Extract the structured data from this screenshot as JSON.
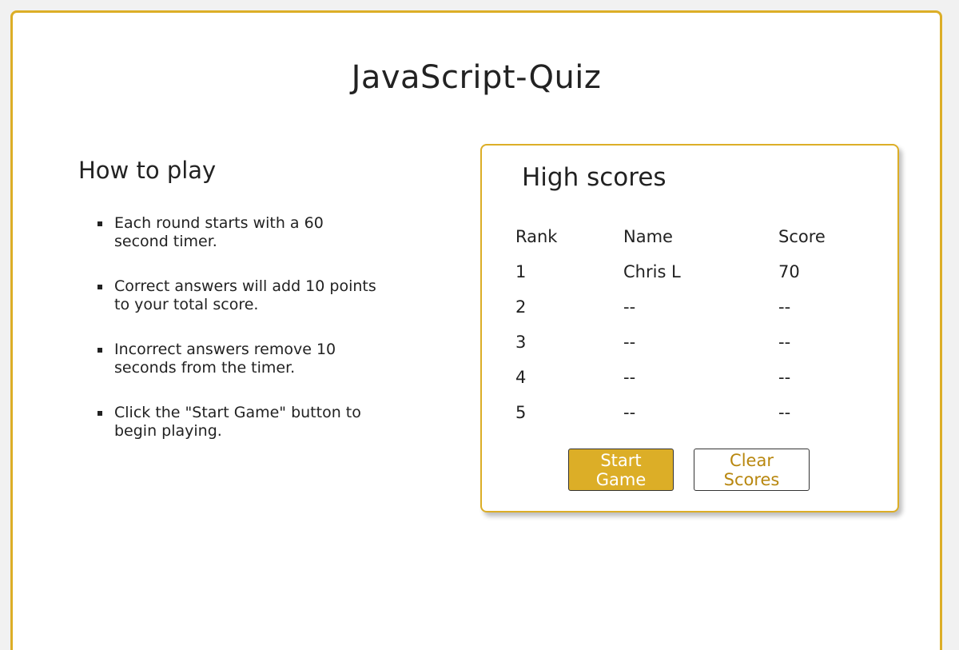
{
  "app": {
    "title": "JavaScript-Quiz"
  },
  "howto": {
    "heading": "How to play",
    "items": [
      "Each round starts with a 60 second timer.",
      "Correct answers will add 10 points to your total score.",
      "Incorrect answers remove 10 seconds from the timer.",
      "Click the \"Start Game\" button to begin playing."
    ]
  },
  "scores": {
    "heading": "High scores",
    "columns": [
      "Rank",
      "Name",
      "Score"
    ],
    "rows": [
      {
        "rank": "1",
        "name": "Chris L",
        "score": "70"
      },
      {
        "rank": "2",
        "name": "--",
        "score": "--"
      },
      {
        "rank": "3",
        "name": "--",
        "score": "--"
      },
      {
        "rank": "4",
        "name": "--",
        "score": "--"
      },
      {
        "rank": "5",
        "name": "--",
        "score": "--"
      }
    ]
  },
  "buttons": {
    "start_label": "Start Game",
    "clear_label": "Clear Scores"
  },
  "colors": {
    "accent": "#dcae27",
    "clear_text": "#b8870f"
  }
}
